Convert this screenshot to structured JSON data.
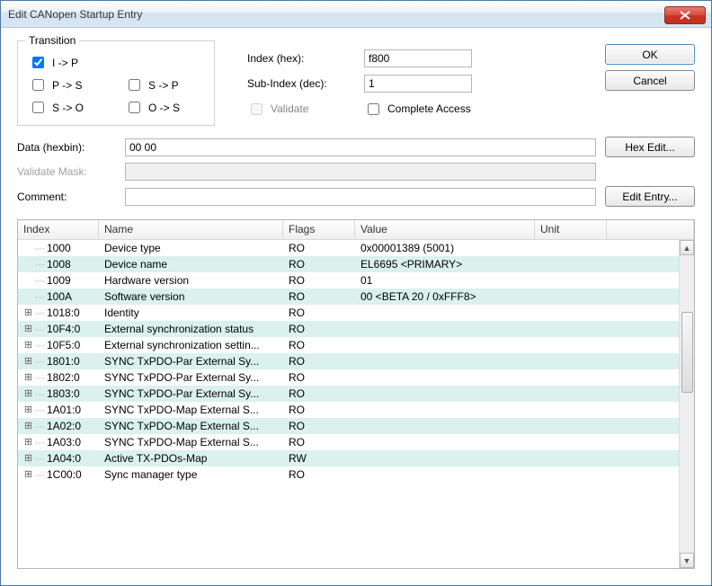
{
  "window": {
    "title": "Edit CANopen Startup Entry"
  },
  "transition": {
    "legend": "Transition",
    "items": [
      {
        "label": "I -> P",
        "checked": true
      },
      {
        "label": "P -> S",
        "checked": false
      },
      {
        "label": "S -> P",
        "checked": false
      },
      {
        "label": "S -> O",
        "checked": false
      },
      {
        "label": "O -> S",
        "checked": false
      }
    ]
  },
  "fields": {
    "index_label": "Index (hex):",
    "index_value": "f800",
    "subindex_label": "Sub-Index (dec):",
    "subindex_value": "1",
    "validate_label": "Validate",
    "complete_label": "Complete Access"
  },
  "buttons": {
    "ok": "OK",
    "cancel": "Cancel",
    "hex_edit": "Hex Edit...",
    "edit_entry": "Edit Entry..."
  },
  "mid": {
    "data_label": "Data (hexbin):",
    "data_value": "00 00",
    "mask_label": "Validate Mask:",
    "mask_value": "",
    "comment_label": "Comment:",
    "comment_value": ""
  },
  "table": {
    "headers": {
      "index": "Index",
      "name": "Name",
      "flags": "Flags",
      "value": "Value",
      "unit": "Unit"
    },
    "rows": [
      {
        "index": "1000",
        "name": "Device type",
        "flags": "RO",
        "value": "0x00001389 (5001)",
        "exp": false,
        "alt": false
      },
      {
        "index": "1008",
        "name": "Device name",
        "flags": "RO",
        "value": "EL6695 <PRIMARY>",
        "exp": false,
        "alt": true
      },
      {
        "index": "1009",
        "name": "Hardware version",
        "flags": "RO",
        "value": "01",
        "exp": false,
        "alt": false
      },
      {
        "index": "100A",
        "name": "Software version",
        "flags": "RO",
        "value": "00 <BETA 20 / 0xFFF8>",
        "exp": false,
        "alt": true
      },
      {
        "index": "1018:0",
        "name": "Identity",
        "flags": "RO",
        "value": "",
        "exp": true,
        "alt": false
      },
      {
        "index": "10F4:0",
        "name": "External synchronization status",
        "flags": "RO",
        "value": "",
        "exp": true,
        "alt": true
      },
      {
        "index": "10F5:0",
        "name": "External synchronization settin...",
        "flags": "RO",
        "value": "",
        "exp": true,
        "alt": false
      },
      {
        "index": "1801:0",
        "name": "SYNC TxPDO-Par External Sy...",
        "flags": "RO",
        "value": "",
        "exp": true,
        "alt": true
      },
      {
        "index": "1802:0",
        "name": "SYNC TxPDO-Par External Sy...",
        "flags": "RO",
        "value": "",
        "exp": true,
        "alt": false
      },
      {
        "index": "1803:0",
        "name": "SYNC TxPDO-Par External Sy...",
        "flags": "RO",
        "value": "",
        "exp": true,
        "alt": true
      },
      {
        "index": "1A01:0",
        "name": "SYNC TxPDO-Map External S...",
        "flags": "RO",
        "value": "",
        "exp": true,
        "alt": false
      },
      {
        "index": "1A02:0",
        "name": "SYNC TxPDO-Map External S...",
        "flags": "RO",
        "value": "",
        "exp": true,
        "alt": true
      },
      {
        "index": "1A03:0",
        "name": "SYNC TxPDO-Map External S...",
        "flags": "RO",
        "value": "",
        "exp": true,
        "alt": false
      },
      {
        "index": "1A04:0",
        "name": "Active TX-PDOs-Map",
        "flags": "RW",
        "value": "",
        "exp": true,
        "alt": true
      },
      {
        "index": "1C00:0",
        "name": "Sync manager type",
        "flags": "RO",
        "value": "",
        "exp": true,
        "alt": false
      }
    ]
  }
}
